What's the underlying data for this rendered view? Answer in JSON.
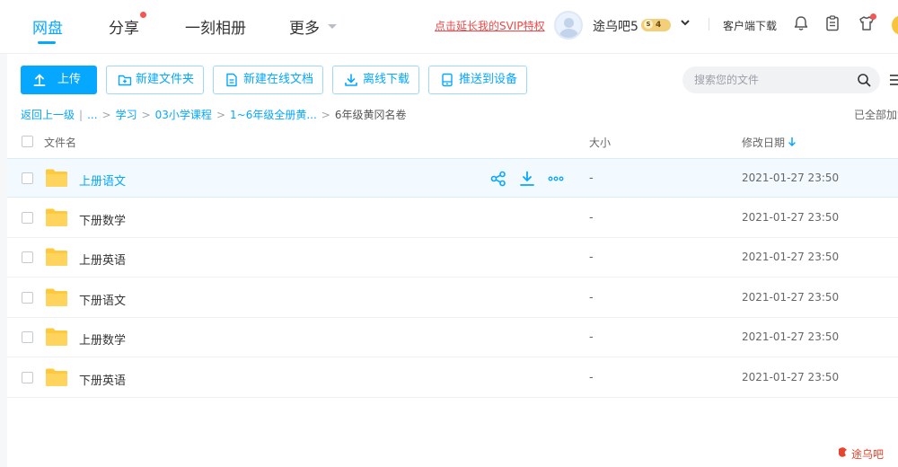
{
  "nav": {
    "items": [
      {
        "label": "网盘",
        "active": true
      },
      {
        "label": "分享",
        "badge": true
      },
      {
        "label": "一刻相册"
      },
      {
        "label": "更多"
      }
    ]
  },
  "header": {
    "svip_promo": "点击延长我的SVIP特权",
    "username": "途乌吧5",
    "vip_level": "4",
    "vip_letter": "S",
    "client_download": "客户端下载"
  },
  "toolbar": {
    "upload": "上传",
    "new_folder": "新建文件夹",
    "new_online_doc": "新建在线文档",
    "offline_download": "离线下载",
    "push_to_device": "推送到设备",
    "search_placeholder": "搜索您的文件"
  },
  "breadcrumb": {
    "back": "返回上一级",
    "ellipsis": "...",
    "crumbs": [
      "学习",
      "03小学课程",
      "1~6年级全册黄..."
    ],
    "current": "6年级黄冈名卷",
    "loaded_all": "已全部加载"
  },
  "table": {
    "headers": {
      "name": "文件名",
      "size": "大小",
      "modified": "修改日期"
    },
    "sort_column": "modified",
    "sort_direction": "descending",
    "rows": [
      {
        "name": "上册语文",
        "size": "-",
        "modified": "2021-01-27 23:50",
        "hover": true
      },
      {
        "name": "下册数学",
        "size": "-",
        "modified": "2021-01-27 23:50"
      },
      {
        "name": "上册英语",
        "size": "-",
        "modified": "2021-01-27 23:50"
      },
      {
        "name": "下册语文",
        "size": "-",
        "modified": "2021-01-27 23:50"
      },
      {
        "name": "上册数学",
        "size": "-",
        "modified": "2021-01-27 23:50"
      },
      {
        "name": "下册英语",
        "size": "-",
        "modified": "2021-01-27 23:50"
      }
    ],
    "row_actions": [
      "share-icon",
      "download-icon",
      "more-icon"
    ]
  },
  "icons": {
    "top_right": [
      "bell-icon",
      "clipboard-icon",
      "tshirt-icon"
    ],
    "folder": "folder-icon"
  },
  "colors": {
    "accent": "#06a7ff",
    "promo": "#f04848",
    "folder": "#ffc93d",
    "hover_row": "#f2f9ff"
  },
  "watermark": "途乌吧"
}
